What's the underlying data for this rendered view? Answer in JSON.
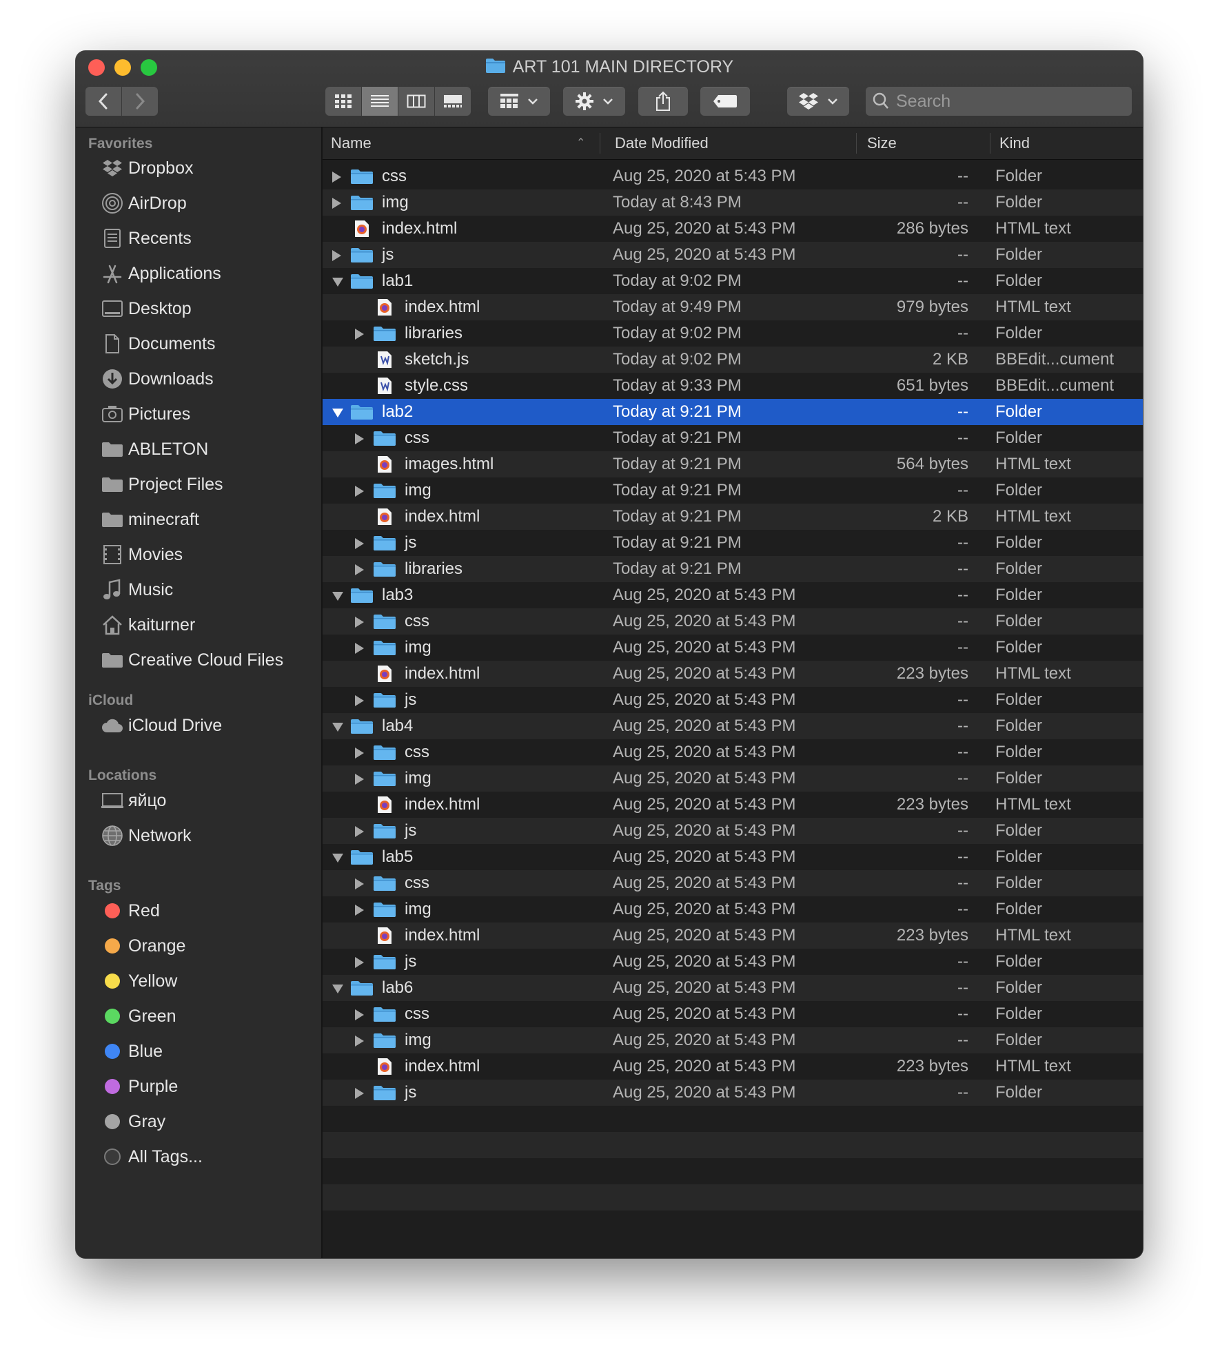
{
  "window": {
    "title": "ART 101 MAIN DIRECTORY"
  },
  "search": {
    "placeholder": "Search"
  },
  "columns": {
    "name": "Name",
    "date": "Date Modified",
    "size": "Size",
    "kind": "Kind"
  },
  "sidebar": {
    "favorites_header": "Favorites",
    "favorites": [
      {
        "label": "Dropbox",
        "icon": "dropbox-icon"
      },
      {
        "label": "AirDrop",
        "icon": "airdrop-icon"
      },
      {
        "label": "Recents",
        "icon": "recents-icon"
      },
      {
        "label": "Applications",
        "icon": "applications-icon"
      },
      {
        "label": "Desktop",
        "icon": "desktop-icon"
      },
      {
        "label": "Documents",
        "icon": "documents-icon"
      },
      {
        "label": "Downloads",
        "icon": "downloads-icon"
      },
      {
        "label": "Pictures",
        "icon": "pictures-icon"
      },
      {
        "label": "ABLETON",
        "icon": "folder-icon"
      },
      {
        "label": "Project Files",
        "icon": "folder-icon"
      },
      {
        "label": "minecraft",
        "icon": "folder-icon"
      },
      {
        "label": "Movies",
        "icon": "movies-icon"
      },
      {
        "label": "Music",
        "icon": "music-icon"
      },
      {
        "label": "kaiturner",
        "icon": "home-icon"
      },
      {
        "label": "Creative Cloud Files",
        "icon": "folder-icon"
      }
    ],
    "icloud_header": "iCloud",
    "icloud": [
      {
        "label": "iCloud Drive",
        "icon": "cloud-icon"
      }
    ],
    "locations_header": "Locations",
    "locations": [
      {
        "label": "яйцо",
        "icon": "computer-icon"
      },
      {
        "label": "Network",
        "icon": "network-icon"
      }
    ],
    "tags_header": "Tags",
    "tags": [
      {
        "label": "Red",
        "color": "#fe5f57"
      },
      {
        "label": "Orange",
        "color": "#f5a94a"
      },
      {
        "label": "Yellow",
        "color": "#f7dc4b"
      },
      {
        "label": "Green",
        "color": "#5bd861"
      },
      {
        "label": "Blue",
        "color": "#3f86f5"
      },
      {
        "label": "Purple",
        "color": "#c06be0"
      },
      {
        "label": "Gray",
        "color": "#a5a5a5"
      },
      {
        "label": "All Tags...",
        "color": "all"
      }
    ]
  },
  "files": [
    {
      "name": "css",
      "date": "Aug 25, 2020 at 5:43 PM",
      "size": "--",
      "kind": "Folder",
      "level": 0,
      "type": "folder",
      "disclosure": "closed"
    },
    {
      "name": "img",
      "date": "Today at 8:43 PM",
      "size": "--",
      "kind": "Folder",
      "level": 0,
      "type": "folder",
      "disclosure": "closed"
    },
    {
      "name": "index.html",
      "date": "Aug 25, 2020 at 5:43 PM",
      "size": "286 bytes",
      "kind": "HTML text",
      "level": 0,
      "type": "html",
      "disclosure": "none"
    },
    {
      "name": "js",
      "date": "Aug 25, 2020 at 5:43 PM",
      "size": "--",
      "kind": "Folder",
      "level": 0,
      "type": "folder",
      "disclosure": "closed"
    },
    {
      "name": "lab1",
      "date": "Today at 9:02 PM",
      "size": "--",
      "kind": "Folder",
      "level": 0,
      "type": "folder",
      "disclosure": "open"
    },
    {
      "name": "index.html",
      "date": "Today at 9:49 PM",
      "size": "979 bytes",
      "kind": "HTML text",
      "level": 1,
      "type": "html",
      "disclosure": "none"
    },
    {
      "name": "libraries",
      "date": "Today at 9:02 PM",
      "size": "--",
      "kind": "Folder",
      "level": 1,
      "type": "folder",
      "disclosure": "closed"
    },
    {
      "name": "sketch.js",
      "date": "Today at 9:02 PM",
      "size": "2 KB",
      "kind": "BBEdit...cument",
      "level": 1,
      "type": "bbedit",
      "disclosure": "none"
    },
    {
      "name": "style.css",
      "date": "Today at 9:33 PM",
      "size": "651 bytes",
      "kind": "BBEdit...cument",
      "level": 1,
      "type": "bbedit",
      "disclosure": "none"
    },
    {
      "name": "lab2",
      "date": "Today at 9:21 PM",
      "size": "--",
      "kind": "Folder",
      "level": 0,
      "type": "folder",
      "disclosure": "open",
      "selected": true
    },
    {
      "name": "css",
      "date": "Today at 9:21 PM",
      "size": "--",
      "kind": "Folder",
      "level": 1,
      "type": "folder",
      "disclosure": "closed"
    },
    {
      "name": "images.html",
      "date": "Today at 9:21 PM",
      "size": "564 bytes",
      "kind": "HTML text",
      "level": 1,
      "type": "html",
      "disclosure": "none"
    },
    {
      "name": "img",
      "date": "Today at 9:21 PM",
      "size": "--",
      "kind": "Folder",
      "level": 1,
      "type": "folder",
      "disclosure": "closed"
    },
    {
      "name": "index.html",
      "date": "Today at 9:21 PM",
      "size": "2 KB",
      "kind": "HTML text",
      "level": 1,
      "type": "html",
      "disclosure": "none"
    },
    {
      "name": "js",
      "date": "Today at 9:21 PM",
      "size": "--",
      "kind": "Folder",
      "level": 1,
      "type": "folder",
      "disclosure": "closed"
    },
    {
      "name": "libraries",
      "date": "Today at 9:21 PM",
      "size": "--",
      "kind": "Folder",
      "level": 1,
      "type": "folder",
      "disclosure": "closed"
    },
    {
      "name": "lab3",
      "date": "Aug 25, 2020 at 5:43 PM",
      "size": "--",
      "kind": "Folder",
      "level": 0,
      "type": "folder",
      "disclosure": "open"
    },
    {
      "name": "css",
      "date": "Aug 25, 2020 at 5:43 PM",
      "size": "--",
      "kind": "Folder",
      "level": 1,
      "type": "folder",
      "disclosure": "closed"
    },
    {
      "name": "img",
      "date": "Aug 25, 2020 at 5:43 PM",
      "size": "--",
      "kind": "Folder",
      "level": 1,
      "type": "folder",
      "disclosure": "closed"
    },
    {
      "name": "index.html",
      "date": "Aug 25, 2020 at 5:43 PM",
      "size": "223 bytes",
      "kind": "HTML text",
      "level": 1,
      "type": "html",
      "disclosure": "none"
    },
    {
      "name": "js",
      "date": "Aug 25, 2020 at 5:43 PM",
      "size": "--",
      "kind": "Folder",
      "level": 1,
      "type": "folder",
      "disclosure": "closed"
    },
    {
      "name": "lab4",
      "date": "Aug 25, 2020 at 5:43 PM",
      "size": "--",
      "kind": "Folder",
      "level": 0,
      "type": "folder",
      "disclosure": "open"
    },
    {
      "name": "css",
      "date": "Aug 25, 2020 at 5:43 PM",
      "size": "--",
      "kind": "Folder",
      "level": 1,
      "type": "folder",
      "disclosure": "closed"
    },
    {
      "name": "img",
      "date": "Aug 25, 2020 at 5:43 PM",
      "size": "--",
      "kind": "Folder",
      "level": 1,
      "type": "folder",
      "disclosure": "closed"
    },
    {
      "name": "index.html",
      "date": "Aug 25, 2020 at 5:43 PM",
      "size": "223 bytes",
      "kind": "HTML text",
      "level": 1,
      "type": "html",
      "disclosure": "none"
    },
    {
      "name": "js",
      "date": "Aug 25, 2020 at 5:43 PM",
      "size": "--",
      "kind": "Folder",
      "level": 1,
      "type": "folder",
      "disclosure": "closed"
    },
    {
      "name": "lab5",
      "date": "Aug 25, 2020 at 5:43 PM",
      "size": "--",
      "kind": "Folder",
      "level": 0,
      "type": "folder",
      "disclosure": "open"
    },
    {
      "name": "css",
      "date": "Aug 25, 2020 at 5:43 PM",
      "size": "--",
      "kind": "Folder",
      "level": 1,
      "type": "folder",
      "disclosure": "closed"
    },
    {
      "name": "img",
      "date": "Aug 25, 2020 at 5:43 PM",
      "size": "--",
      "kind": "Folder",
      "level": 1,
      "type": "folder",
      "disclosure": "closed"
    },
    {
      "name": "index.html",
      "date": "Aug 25, 2020 at 5:43 PM",
      "size": "223 bytes",
      "kind": "HTML text",
      "level": 1,
      "type": "html",
      "disclosure": "none"
    },
    {
      "name": "js",
      "date": "Aug 25, 2020 at 5:43 PM",
      "size": "--",
      "kind": "Folder",
      "level": 1,
      "type": "folder",
      "disclosure": "closed"
    },
    {
      "name": "lab6",
      "date": "Aug 25, 2020 at 5:43 PM",
      "size": "--",
      "kind": "Folder",
      "level": 0,
      "type": "folder",
      "disclosure": "open"
    },
    {
      "name": "css",
      "date": "Aug 25, 2020 at 5:43 PM",
      "size": "--",
      "kind": "Folder",
      "level": 1,
      "type": "folder",
      "disclosure": "closed"
    },
    {
      "name": "img",
      "date": "Aug 25, 2020 at 5:43 PM",
      "size": "--",
      "kind": "Folder",
      "level": 1,
      "type": "folder",
      "disclosure": "closed"
    },
    {
      "name": "index.html",
      "date": "Aug 25, 2020 at 5:43 PM",
      "size": "223 bytes",
      "kind": "HTML text",
      "level": 1,
      "type": "html",
      "disclosure": "none"
    },
    {
      "name": "js",
      "date": "Aug 25, 2020 at 5:43 PM",
      "size": "--",
      "kind": "Folder",
      "level": 1,
      "type": "folder",
      "disclosure": "closed"
    }
  ],
  "colors": {
    "selection": "#1f5bc8",
    "folder": "#5aaee8"
  }
}
